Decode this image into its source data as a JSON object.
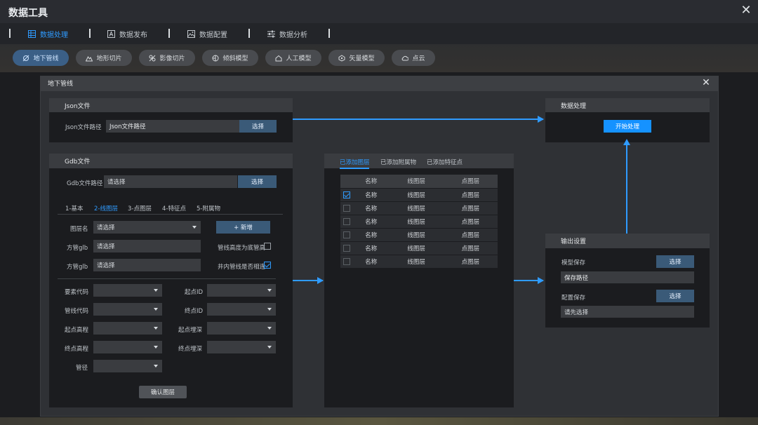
{
  "app": {
    "title": "数据工具"
  },
  "tabs": [
    {
      "label": "数据处理",
      "icon": "table-icon"
    },
    {
      "label": "数据发布",
      "icon": "letter-a-icon"
    },
    {
      "label": "数据配置",
      "icon": "image-icon"
    },
    {
      "label": "数据分析",
      "icon": "sliders-icon"
    }
  ],
  "subtabs": [
    {
      "label": "地下管线",
      "icon": "pipe-icon"
    },
    {
      "label": "地形切片",
      "icon": "terrain-icon"
    },
    {
      "label": "影像切片",
      "icon": "image-slice-icon"
    },
    {
      "label": "倾斜模型",
      "icon": "oblique-icon"
    },
    {
      "label": "人工模型",
      "icon": "house-icon"
    },
    {
      "label": "矢量模型",
      "icon": "vector-icon"
    },
    {
      "label": "点云",
      "icon": "cloud-icon"
    }
  ],
  "dialog": {
    "title": "地下管线",
    "json": {
      "header": "Json文件",
      "label": "Json文件路径",
      "value": "Json文件路径",
      "button": "选择"
    },
    "gdb": {
      "header": "Gdb文件",
      "label": "Gdb文件路径",
      "placeholder": "请选择",
      "button": "选择",
      "tabs": [
        "1-基本",
        "2-线图层",
        "3-点图层",
        "4-特征点",
        "5-附属物"
      ],
      "layer_name_label": "图层名",
      "layer_name_value": "请选择",
      "add_button": "+ 新增",
      "glb1_label": "方管glb",
      "glb1_value": "请选择",
      "glb2_label": "方管glb",
      "glb2_value": "请选择",
      "bottom_elev_label": "管线高度为底管高",
      "inner_same_label": "井内管线是否相连",
      "fields": [
        "要素代码",
        "起点ID",
        "管线代码",
        "终点ID",
        "起点高程",
        "起点埋深",
        "终点高程",
        "终点埋深",
        "管径"
      ],
      "confirm_button": "确认图层"
    },
    "layers": {
      "tabs": [
        "已添加图层",
        "已添加附属物",
        "已添加特征点"
      ],
      "columns": [
        "名称",
        "线图层",
        "点图层"
      ],
      "rows": [
        {
          "checked": true,
          "name": "名称",
          "line": "线图层",
          "point": "点图层"
        },
        {
          "checked": false,
          "name": "名称",
          "line": "线图层",
          "point": "点图层"
        },
        {
          "checked": false,
          "name": "名称",
          "line": "线图层",
          "point": "点图层"
        },
        {
          "checked": false,
          "name": "名称",
          "line": "线图层",
          "point": "点图层"
        },
        {
          "checked": false,
          "name": "名称",
          "line": "线图层",
          "point": "点图层"
        },
        {
          "checked": false,
          "name": "名称",
          "line": "线图层",
          "point": "点图层"
        }
      ]
    },
    "process": {
      "header": "数据处理",
      "button": "开始处理"
    },
    "output": {
      "header": "输出设置",
      "model_label": "模型保存",
      "model_button": "选择",
      "model_path": "保存路径",
      "config_label": "配置保存",
      "config_button": "选择",
      "config_placeholder": "请先选择"
    }
  },
  "colors": {
    "accent": "#2f9bff",
    "primary_button": "#1592ff"
  }
}
